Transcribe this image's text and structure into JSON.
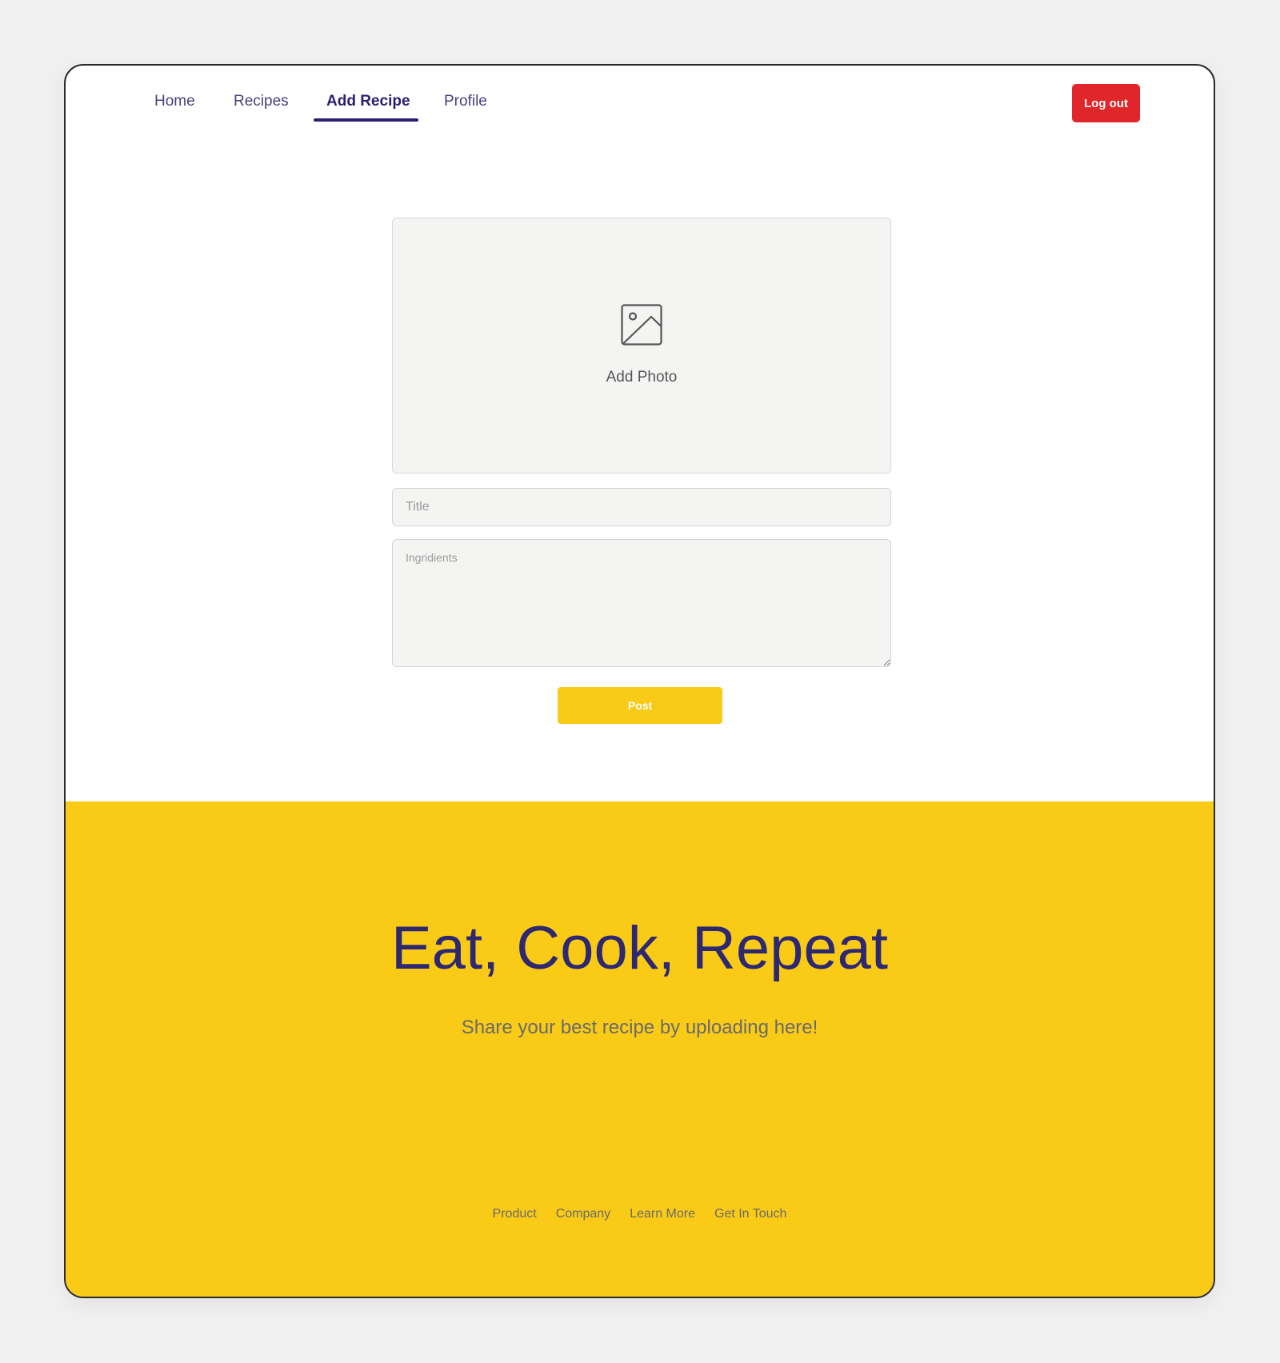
{
  "nav": {
    "items": [
      {
        "label": "Home"
      },
      {
        "label": "Recipes"
      },
      {
        "label": "Add Recipe",
        "active": true
      },
      {
        "label": "Profile"
      }
    ],
    "logout_label": "Log out"
  },
  "form": {
    "photo_label": "Add Photo",
    "photo_icon": "image-icon",
    "title_placeholder": "Title",
    "title_value": "",
    "ingredients_placeholder": "Ingridients",
    "ingredients_value": "",
    "post_label": "Post"
  },
  "hero": {
    "title": "Eat, Cook, Repeat",
    "subtitle": "Share your best recipe by uploading here!"
  },
  "footer": {
    "links": [
      "Product",
      "Company",
      "Learn More",
      "Get In Touch"
    ]
  },
  "colors": {
    "accent_yellow": "#f9cb17",
    "navy": "#2e2870",
    "logout_red": "#e0262a",
    "input_bg": "#f4f4f3",
    "page_bg": "#f0f0f0"
  }
}
